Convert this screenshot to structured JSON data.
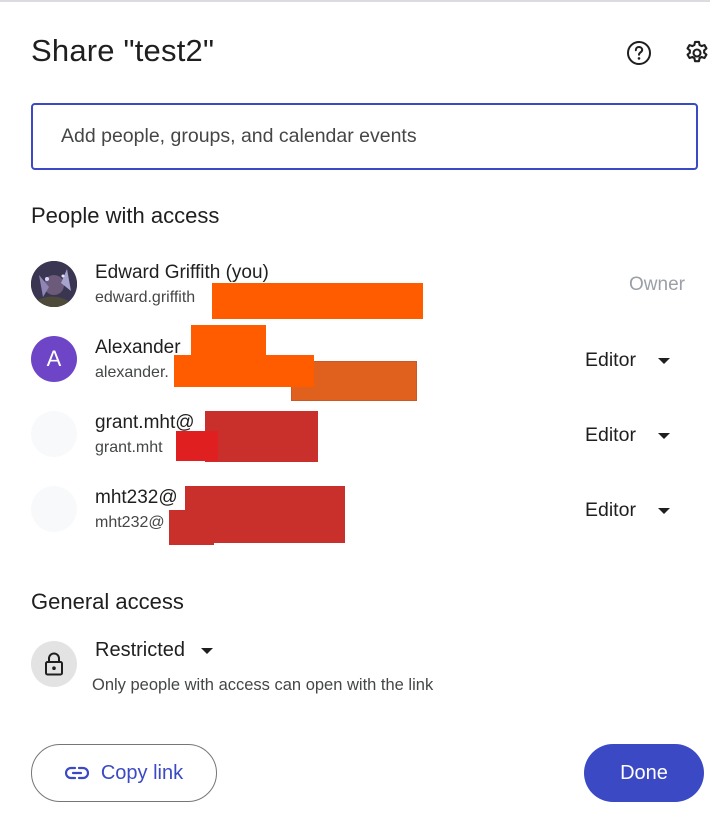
{
  "dialog": {
    "title": "Share \"test2\""
  },
  "search": {
    "placeholder": "Add people, groups, and calendar events"
  },
  "people_section": {
    "heading": "People with access",
    "people": [
      {
        "avatar_initial": "",
        "name": "Edward Griffith (you)",
        "email": "edward.griffith",
        "role": "Owner"
      },
      {
        "avatar_initial": "A",
        "name": "Alexander",
        "email": "alexander.",
        "role": "Editor"
      },
      {
        "avatar_initial": "",
        "name": "grant.mht@",
        "email": "grant.mht",
        "role": "Editor"
      },
      {
        "avatar_initial": "",
        "name": "mht232@",
        "email": "mht232@",
        "role": "Editor"
      }
    ]
  },
  "general_access": {
    "heading": "General access",
    "level": "Restricted",
    "description": "Only people with access can open with the link"
  },
  "footer": {
    "copy_link_label": "Copy link",
    "done_label": "Done"
  },
  "colors": {
    "accent": "#3b49c4",
    "avatar_purple": "#6e45c6",
    "redact_orange": "#ff5c00",
    "redact_red": "#c9302c"
  }
}
